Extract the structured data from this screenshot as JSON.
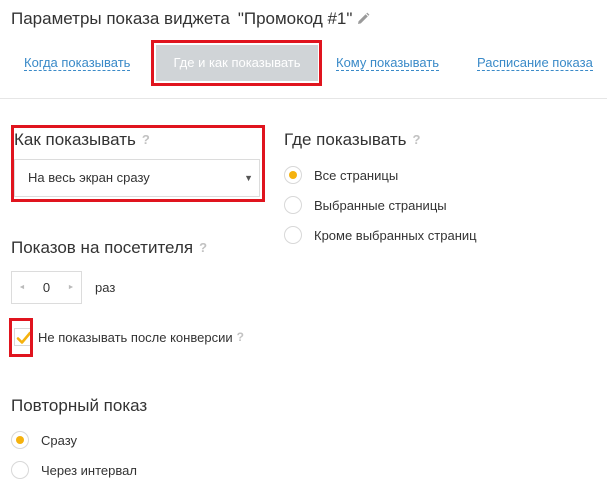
{
  "header": {
    "title": "Параметры показа виджета",
    "widget_name": "\"Промокод #1\""
  },
  "tabs": {
    "when": "Когда показывать",
    "where_how": "Где и как показывать",
    "whom": "Кому показывать",
    "schedule": "Расписание показа"
  },
  "how": {
    "title": "Как показывать",
    "select_value": "На весь экран сразу"
  },
  "where": {
    "title": "Где показывать",
    "options": [
      "Все страницы",
      "Выбранные страницы",
      "Кроме выбранных страниц"
    ],
    "selected_index": 0
  },
  "views": {
    "title": "Показов на посетителя",
    "value": "0",
    "unit": "раз"
  },
  "conversion": {
    "label": "Не показывать после конверсии",
    "checked": true
  },
  "repeat": {
    "title": "Повторный показ",
    "options": [
      "Сразу",
      "Через интервал"
    ],
    "selected_index": 0
  },
  "icons": {
    "help": "?",
    "pencil": "pencil-icon",
    "caret": "▼",
    "decrement": "◄",
    "increment": "►"
  },
  "colors": {
    "link": "#3a8ac8",
    "active_tab_bg": "#d0d4d7",
    "accent": "#f5b20e",
    "highlight": "#e0141e"
  }
}
